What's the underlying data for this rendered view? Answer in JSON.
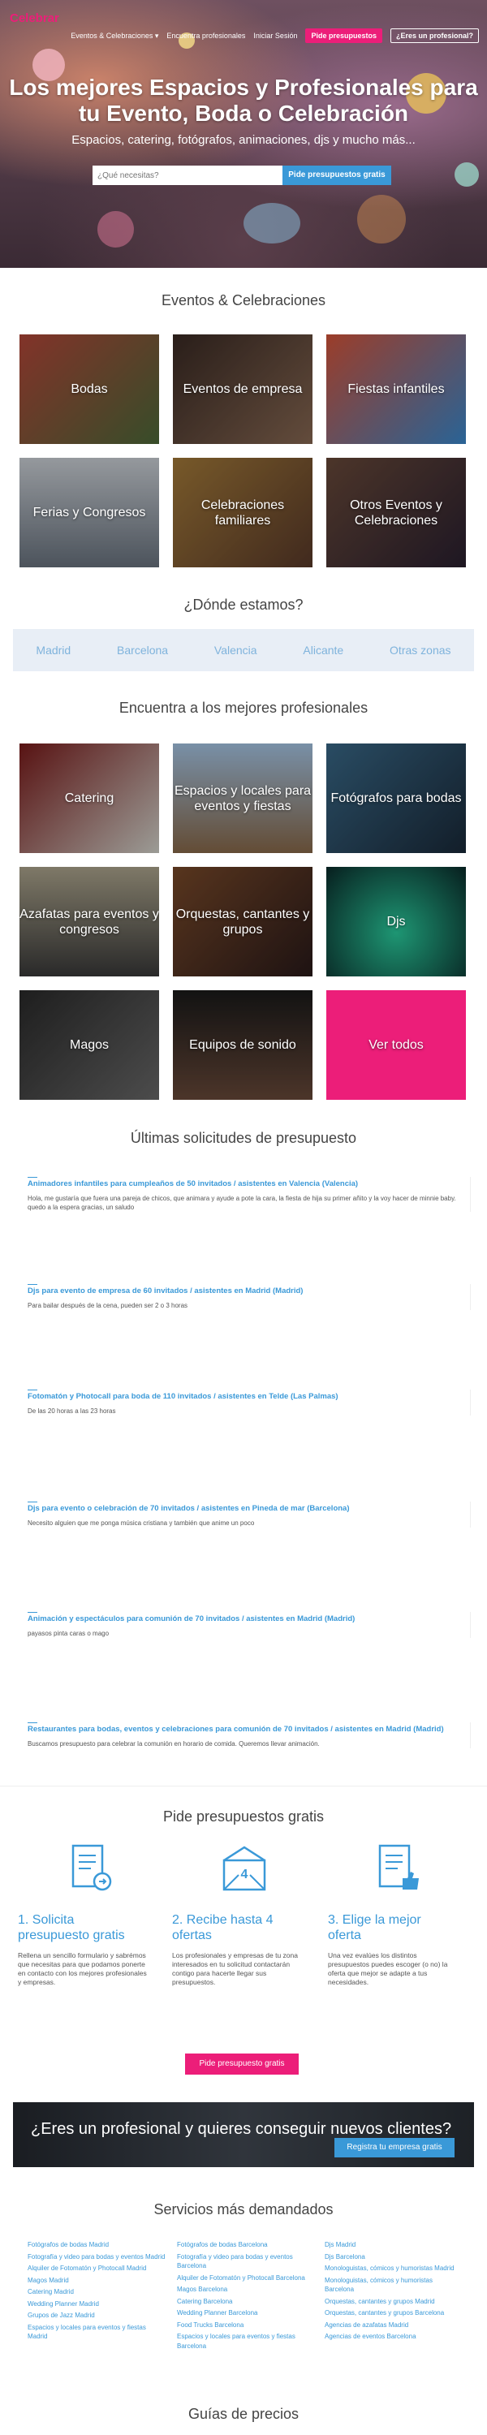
{
  "brand": {
    "logo": "Celebrar"
  },
  "nav": {
    "item1": "Eventos & Celebraciones ▾",
    "item2": "Encuentra profesionales",
    "item3": "Iniciar Sesión",
    "cta": "Pide presupuestos",
    "pro": "¿Eres un profesional?"
  },
  "hero": {
    "title": "Los mejores Espacios y Profesionales para tu Evento, Boda o Celebración",
    "subtitle": "Espacios, catering, fotógrafos, animaciones, djs y mucho más...",
    "search_placeholder": "¿Qué necesitas?",
    "search_button": "Pide presupuestos gratis"
  },
  "events": {
    "title": "Eventos & Celebraciones",
    "tiles": [
      "Bodas",
      "Eventos de empresa",
      "Fiestas infantiles",
      "Ferias y Congresos",
      "Celebraciones familiares",
      "Otros Eventos y Celebraciones"
    ]
  },
  "where": {
    "title": "¿Dónde estamos?",
    "cities": [
      "Madrid",
      "Barcelona",
      "Valencia",
      "Alicante",
      "Otras zonas"
    ]
  },
  "pros": {
    "title": "Encuentra a los mejores profesionales",
    "tiles": [
      "Catering",
      "Espacios y locales para eventos y fiestas",
      "Fotógrafos para bodas",
      "Azafatas para eventos y congresos",
      "Orquestas, cantantes y grupos",
      "Djs",
      "Magos",
      "Equipos de sonido",
      "Ver todos"
    ]
  },
  "requests": {
    "title": "Últimas solicitudes de presupuesto",
    "items": [
      {
        "title": "Animadores infantiles para cumpleaños de 50 invitados / asistentes en Valencia (Valencia)",
        "desc": "Hola, me gustaría que fuera una pareja de chicos, que animara y ayude a pote la cara, la fiesta de hija su primer añito y la voy hacer de minnie baby. quedo a la espera gracias, un saludo"
      },
      {
        "title": "Djs para evento de empresa de 60 invitados / asistentes en Madrid (Madrid)",
        "desc": "Para bailar después de la cena, pueden ser 2 o 3 horas"
      },
      {
        "title": "Fotomatón y Photocall para boda de 110 invitados / asistentes en Telde (Las Palmas)",
        "desc": "De las 20 horas a las 23 horas"
      },
      {
        "title": "Djs para evento o celebración de 70 invitados / asistentes en Pineda de mar (Barcelona)",
        "desc": "Necesito alguien que me ponga música cristiana y también que anime un poco"
      },
      {
        "title": "Animación y espectáculos para comunión de 70 invitados / asistentes en Madrid (Madrid)",
        "desc": "payasos pinta caras o mago"
      },
      {
        "title": "Restaurantes para bodas, eventos y celebraciones para comunión de 70 invitados / asistentes en Madrid (Madrid)",
        "desc": "Buscamos presupuesto para celebrar la comunión en horario de comida. Queremos llevar animación."
      }
    ]
  },
  "how": {
    "title": "Pide presupuestos gratis",
    "steps": [
      {
        "title": "1.  Solicita presupuesto gratis",
        "desc": "Rellena un sencillo formulario y sabrémos que necesitas para que podamos ponerte en contacto con los mejores profesionales y empresas."
      },
      {
        "title": "2.  Recibe hasta 4 ofertas",
        "desc": "Los profesionales y empresas de tu zona interesados en tu solicitud contactarán contigo para hacerte llegar sus presupuestos."
      },
      {
        "title": "3.  Elige la mejor oferta",
        "desc": "Una vez evalúes los distintos presupuestos puedes escoger (o no) la oferta que mejor se adapte a tus necesidades."
      }
    ],
    "cta": "Pide presupuesto gratis"
  },
  "banner": {
    "title": "¿Eres un profesional y quieres conseguir nuevos clientes?",
    "button": "Registra tu empresa gratis"
  },
  "services": {
    "title": "Servicios más demandados",
    "col1": [
      "Fotógrafos de bodas Madrid",
      "Fotografía y video para bodas y eventos Madrid",
      "Alquiler de Fotomatón y Photocall Madrid",
      "Magos Madrid",
      "Catering Madrid",
      "Wedding Planner Madrid",
      "Grupos de Jazz Madrid",
      "Espacios y locales para eventos y fiestas Madrid"
    ],
    "col2": [
      "Fotógrafos de bodas Barcelona",
      "Fotografía y video para bodas y eventos Barcelona",
      "Alquiler de Fotomatón y Photocall Barcelona",
      "Magos Barcelona",
      "Catering Barcelona",
      "Wedding Planner Barcelona",
      "Food Trucks Barcelona",
      "Espacios y locales para eventos y fiestas Barcelona"
    ],
    "col3": [
      "Djs Madrid",
      "Djs Barcelona",
      "Monologuistas, cómicos y humoristas Madrid",
      "Monologuistas, cómicos y humoristas Barcelona",
      "Orquestas, cantantes y grupos Madrid",
      "Orquestas, cantantes y grupos Barcelona",
      "Agencias de azafatas Madrid",
      "Agencias de eventos Barcelona"
    ]
  },
  "guides": {
    "title": "Guías de precios"
  },
  "colors": {
    "pink": "#ec1e79",
    "blue": "#3a99d8"
  }
}
